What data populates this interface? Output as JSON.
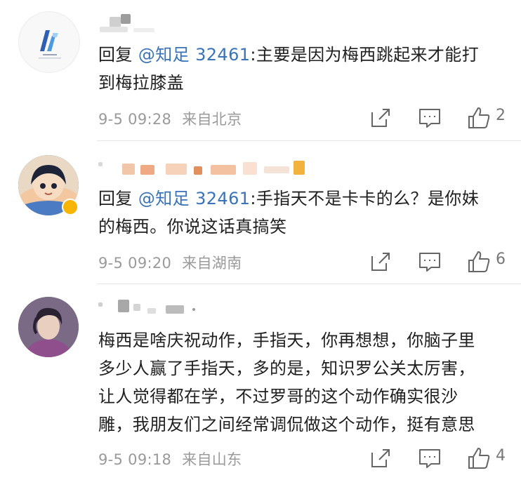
{
  "comments": [
    {
      "reply_prefix": "回复",
      "mention": "@知足 32461",
      "text_line1": ":主要是因为梅西跳起来才能打",
      "text_line2": "到梅拉膝盖",
      "time": "9-5 09:28",
      "location": "来自北京",
      "likes": "2",
      "avatar_icon": "logo-avatar-icon"
    },
    {
      "reply_prefix": "回复",
      "mention": "@知足 32461",
      "text_line1": ":手指天不是卡卡的么？是你妹",
      "text_line2": "的梅西。你说这话真搞笑",
      "time": "9-5 09:20",
      "location": "来自湖南",
      "likes": "6",
      "avatar_icon": "anime-avatar-icon"
    },
    {
      "lines": [
        "梅西是啥庆祝动作，手指天，你再想想，你脑子里",
        "多少人赢了手指天，多的是，知识罗公关太厉害，",
        "让人觉得都在学，不过罗哥的这个动作确实很沙",
        "雕，我朋友们之间经常调侃做这个动作，挺有意思"
      ],
      "time": "9-5 09:18",
      "location": "来自山东",
      "likes": "4",
      "avatar_icon": "person-avatar-icon"
    }
  ],
  "icons": {
    "share": "share-icon",
    "comment": "comment-icon",
    "like": "thumbs-up-icon"
  },
  "colors": {
    "mention": "#3a73b8",
    "meta": "#9a9a9a",
    "divider": "#e6e6e6"
  }
}
